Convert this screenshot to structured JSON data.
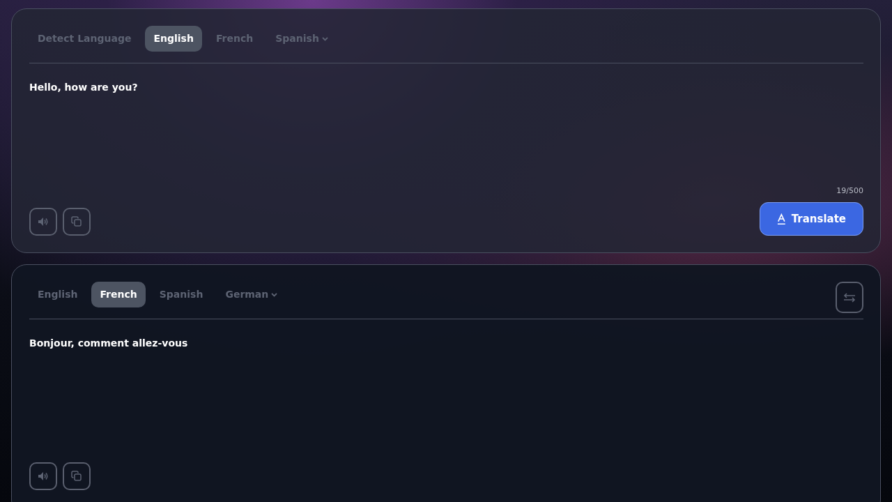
{
  "source": {
    "tabs": [
      {
        "label": "Detect Language",
        "kind": "tab",
        "selected": false
      },
      {
        "label": "English",
        "kind": "tab",
        "selected": true
      },
      {
        "label": "French",
        "kind": "tab",
        "selected": false
      },
      {
        "label": "Spanish",
        "kind": "dropdown",
        "selected": false
      }
    ],
    "text": "Hello, how are you?",
    "counter": "19/500",
    "translate_button": "Translate"
  },
  "target": {
    "tabs": [
      {
        "label": "English",
        "kind": "tab",
        "selected": false
      },
      {
        "label": "French",
        "kind": "tab",
        "selected": true
      },
      {
        "label": "Spanish",
        "kind": "tab",
        "selected": false
      },
      {
        "label": "German",
        "kind": "dropdown",
        "selected": false
      }
    ],
    "text": "Bonjour, comment allez-vous"
  }
}
